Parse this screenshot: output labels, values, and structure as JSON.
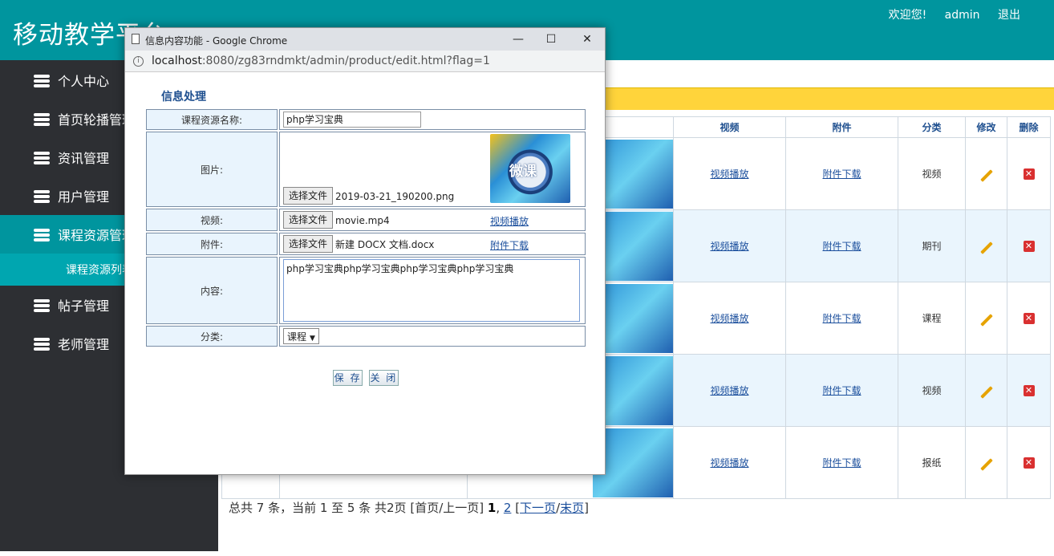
{
  "header": {
    "app_title": "移动教学平台",
    "welcome": "欢迎您!",
    "user": "admin",
    "logout": "退出"
  },
  "sidebar": {
    "items": [
      {
        "label": "个人中心"
      },
      {
        "label": "首页轮播管理"
      },
      {
        "label": "资讯管理"
      },
      {
        "label": "用户管理"
      },
      {
        "label": "课程资源管理"
      },
      {
        "label": "帖子管理"
      },
      {
        "label": "老师管理"
      }
    ],
    "sub_item": "课程资源列表"
  },
  "table": {
    "headers": [
      "视频",
      "附件",
      "分类",
      "修改",
      "删除"
    ],
    "rows": [
      {
        "video": "视频播放",
        "attach": "附件下载",
        "category": "视频"
      },
      {
        "video": "视频播放",
        "attach": "附件下载",
        "category": "期刊"
      },
      {
        "video": "视频播放",
        "attach": "附件下载",
        "category": "课程"
      },
      {
        "video": "视频播放",
        "attach": "附件下载",
        "category": "视频"
      },
      {
        "video": "视频播放",
        "attach": "附件下载",
        "category": "报纸"
      }
    ]
  },
  "pager": {
    "summary": "总共 7 条，当前 1 至 5 条 共2页",
    "first_prev": "[首页/上一页]",
    "page1": "1",
    "page2": "2",
    "next": "下一页",
    "last": "末页"
  },
  "dialog": {
    "window_title": "信息内容功能 - Google Chrome",
    "url_host": "localhost",
    "url_rest": ":8080/zg83rndmkt/admin/product/edit.html?flag=1",
    "form_title": "信息处理",
    "fields": {
      "name_label": "课程资源名称:",
      "name_value": "php学习宝典",
      "image_label": "图片:",
      "image_button": "选择文件",
      "image_file": "2019-03-21_190200.png",
      "image_preview_text": "微课",
      "video_label": "视频:",
      "video_button": "选择文件",
      "video_file": "movie.mp4",
      "video_link": "视频播放",
      "attach_label": "附件:",
      "attach_button": "选择文件",
      "attach_file": "新建 DOCX 文档.docx",
      "attach_link": "附件下载",
      "content_label": "内容:",
      "content_value": "php学习宝典php学习宝典php学习宝典php学习宝典",
      "category_label": "分类:",
      "category_value": "课程"
    },
    "buttons": {
      "save": "保 存",
      "close": "关 闭"
    }
  }
}
